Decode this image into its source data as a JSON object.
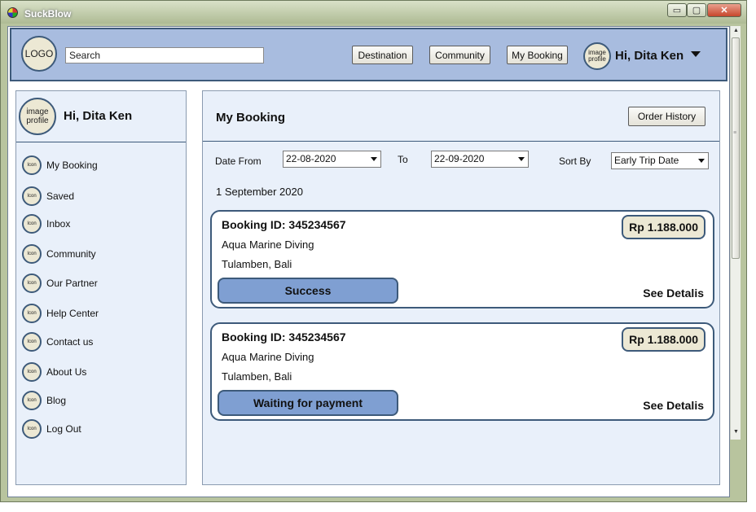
{
  "window": {
    "title": "SuckBlow",
    "minimize": "▭",
    "maximize": "▢",
    "close": "✕",
    "icon": "app-icon"
  },
  "header": {
    "logo": "LOGO",
    "search_value": "Search",
    "nav": [
      "Destination",
      "Community",
      "My Booking"
    ],
    "avatar_label": "image profile",
    "greeting": "Hi, Dita Ken"
  },
  "sidebar": {
    "avatar_label": "image profile",
    "greeting": "Hi, Dita Ken",
    "icon_label": "Icon",
    "items": [
      "My Booking",
      "Saved",
      "Inbox",
      "Community",
      "Our Partner",
      "Help Center",
      "Contact us",
      "About Us",
      "Blog",
      "Log Out"
    ]
  },
  "main": {
    "title": "My Booking",
    "order_history": "Order History",
    "filters": {
      "date_from_label": "Date From",
      "date_from": "22-08-2020",
      "to_label": "To",
      "date_to": "22-09-2020",
      "sort_label": "Sort By",
      "sort_value": "Early Trip Date"
    },
    "date_group": "1 September 2020",
    "bookings": [
      {
        "id": "Booking ID: 345234567",
        "name": "Aqua Marine Diving",
        "location": "Tulamben, Bali",
        "price": "Rp 1.188.000",
        "status": "Success",
        "details": "See Detalis"
      },
      {
        "id": "Booking ID: 345234567",
        "name": "Aqua Marine Diving",
        "location": "Tulamben, Bali",
        "price": "Rp 1.188.000",
        "status": "Waiting for payment",
        "details": "See Detalis"
      }
    ]
  }
}
